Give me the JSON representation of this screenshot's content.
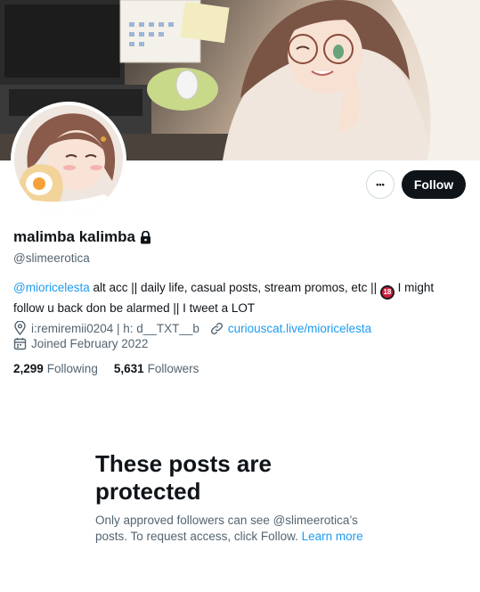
{
  "profile": {
    "display_name": "malimba kalimba",
    "handle": "@slimeerotica",
    "bio": {
      "mention": "@mioricelesta",
      "text_before_badge": " alt acc || daily life, casual posts, stream promos, etc || ",
      "age_badge": "18",
      "text_after_badge": " I might follow u back don be alarmed || I tweet a LOT"
    },
    "location": "i:remiremii0204 | h: d__TXT__b",
    "website": "curiouscat.live/mioricelesta",
    "joined": "Joined February 2022",
    "following_count": "2,299",
    "following_label": "Following",
    "followers_count": "5,631",
    "followers_label": "Followers"
  },
  "actions": {
    "more_label": "•••",
    "follow_label": "Follow"
  },
  "protected": {
    "title": "These posts are protected",
    "body": "Only approved followers can see @slimeerotica’s posts. To request access, click Follow. ",
    "learn_more": "Learn more"
  },
  "colors": {
    "accent": "#1d9bf0",
    "text_primary": "#0f1419",
    "text_secondary": "#536471",
    "follow_bg": "#0f1419"
  },
  "icons": [
    "lock-icon",
    "location-icon",
    "link-icon",
    "calendar-icon",
    "more-icon"
  ]
}
